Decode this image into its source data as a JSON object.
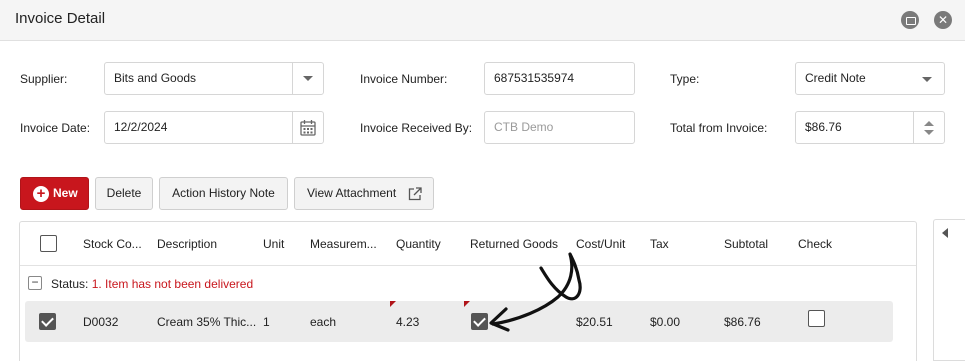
{
  "window": {
    "title": "Invoice Detail",
    "close_glyph": "✕"
  },
  "form": {
    "supplier": {
      "label": "Supplier:",
      "value": "Bits and Goods"
    },
    "invoice_number": {
      "label": "Invoice Number:",
      "value": "687531535974"
    },
    "type": {
      "label": "Type:",
      "value": "Credit Note"
    },
    "invoice_date": {
      "label": "Invoice Date:",
      "value": "12/2/2024"
    },
    "received_by": {
      "label": "Invoice Received By:",
      "placeholder": "CTB Demo"
    },
    "total": {
      "label": "Total from Invoice:",
      "value": "$86.76"
    }
  },
  "toolbar": {
    "new_label": "New",
    "new_glyph": "+",
    "delete_label": "Delete",
    "history_label": "Action History Note",
    "attachment_label": "View Attachment"
  },
  "grid": {
    "columns": [
      "Stock Co...",
      "Description",
      "Unit",
      "Measurem...",
      "Quantity",
      "Returned Goods",
      "Cost/Unit",
      "Tax",
      "Subtotal",
      "Check"
    ],
    "group": {
      "toggle_glyph": "−",
      "prefix": "Status: ",
      "status": "1. Item has not been delivered"
    },
    "rows": [
      {
        "selected": true,
        "stock_code": "D0032",
        "description": "Cream 35% Thic...",
        "unit": "1",
        "measurement": "each",
        "quantity": "4.23",
        "returned_goods": true,
        "cost_unit": "$20.51",
        "tax": "$0.00",
        "subtotal": "$86.76",
        "check": false
      }
    ]
  },
  "icons": {
    "minimize": "minimize-icon",
    "close": "close-icon",
    "dropdown": "chevron-down-icon",
    "calendar": "calendar-icon",
    "spinner": "spinner-icon",
    "new": "plus-icon",
    "external": "external-link-icon",
    "panel_toggle": "chevron-left-icon"
  },
  "colors": {
    "brand_red": "#c8161d",
    "annotation_ink": "#111111"
  }
}
